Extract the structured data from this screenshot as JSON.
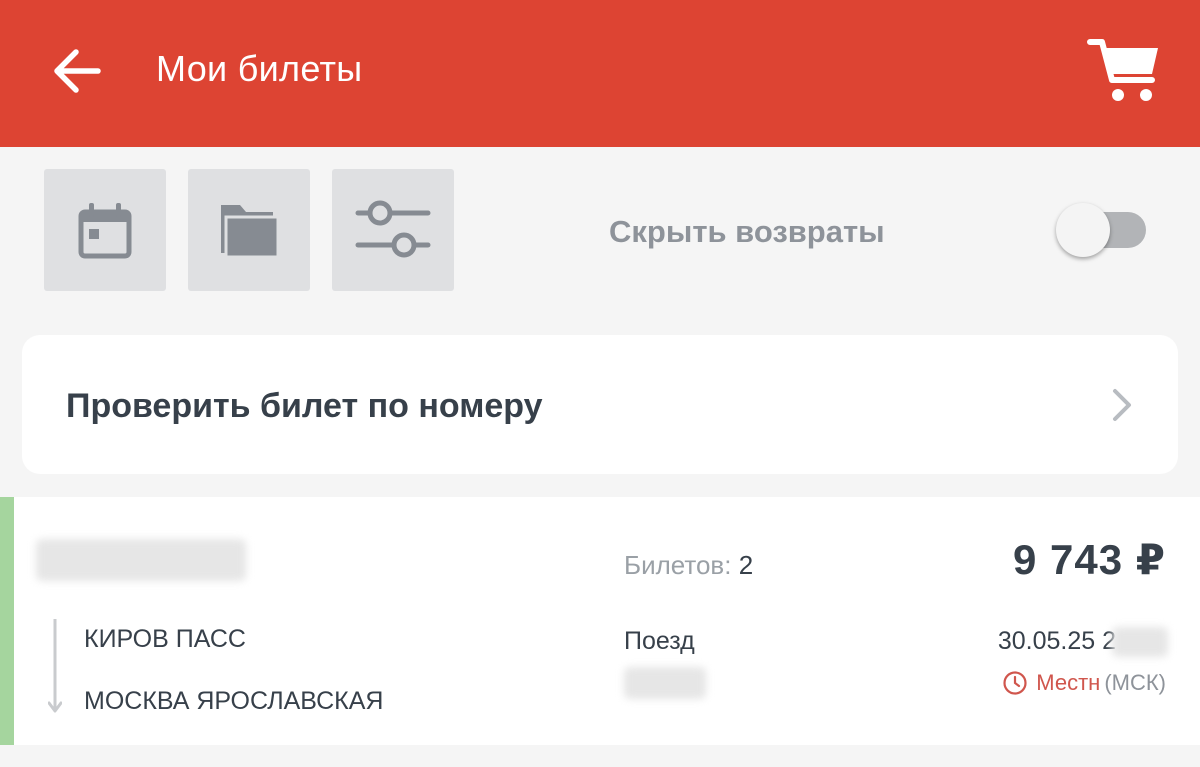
{
  "header": {
    "title": "Мои билеты",
    "back_icon": "arrow-left-icon",
    "cart_icon": "cart-icon",
    "background_color": "#dd4433"
  },
  "toolbar": {
    "calendar_icon": "calendar-icon",
    "folder_icon": "folder-icon",
    "filter_icon": "sliders-icon",
    "hide_returns_label": "Скрыть возвраты",
    "hide_returns_enabled": false
  },
  "check": {
    "label": "Проверить билет по номеру",
    "chevron_icon": "chevron-right-icon"
  },
  "ticket": {
    "accent_color": "#a5d59e",
    "count_label": "Билетов:",
    "count_value": "2",
    "price": "9 743 ₽",
    "from_station": "КИРОВ ПАСС",
    "to_station": "МОСКВА ЯРОСЛАВСКАЯ",
    "transport_label": "Поезд",
    "datetime": "30.05.25 2",
    "tz_local": "Местн",
    "tz_zone": "(МСК)",
    "clock_icon": "clock-icon"
  }
}
